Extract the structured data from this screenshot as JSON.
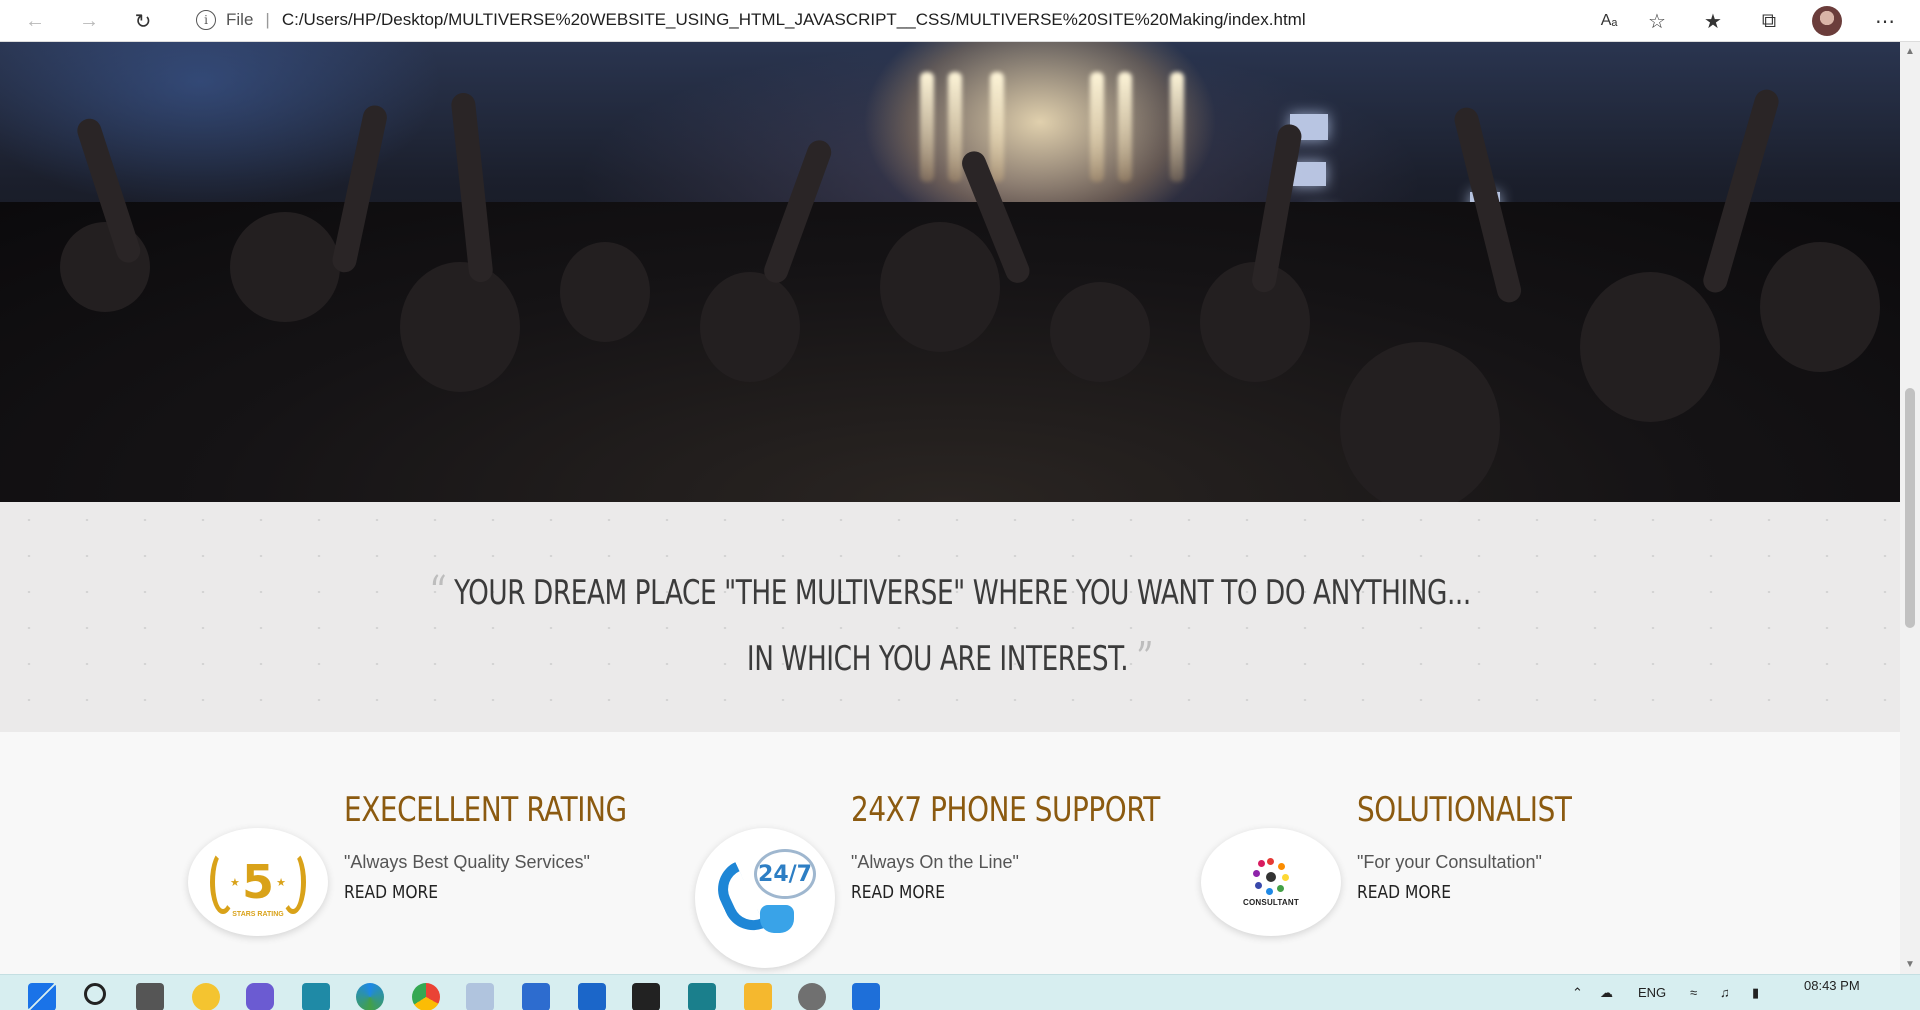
{
  "browser": {
    "back_icon": "back-arrow-icon",
    "forward_icon": "forward-arrow-icon",
    "reload_icon": "reload-icon",
    "info_glyph": "i",
    "file_label": "File",
    "separator": "|",
    "url": "C:/Users/HP/Desktop/MULTIVERSE%20WEBSITE_USING_HTML_JAVASCRIPT__CSS/MULTIVERSE%20SITE%20Making/index.html",
    "read_aloud_glyph": "Aₐ"
  },
  "quote": {
    "open_mark": "“",
    "line1": "YOUR DREAM PLACE \"THE MULTIVERSE\" WHERE YOU WANT TO DO ANYTHING...",
    "line2": "IN WHICH YOU ARE INTEREST.",
    "close_mark": "”"
  },
  "features": [
    {
      "title": "EXECELLENT RATING",
      "subtitle": "\"Always Best Quality Services\"",
      "link": "READ MORE",
      "badge_number": "5",
      "badge_text": "STARS RATING",
      "icon": "five-star-rating-icon"
    },
    {
      "title": "24X7 PHONE SUPPORT",
      "subtitle": "\"Always On the Line\"",
      "link": "READ MORE",
      "badge_text": "24/7",
      "icon": "phone-support-icon"
    },
    {
      "title": "SOLUTIONALIST",
      "subtitle": "\"For your Consultation\"",
      "link": "READ MORE",
      "badge_text": "CONSULTANT",
      "icon": "consultant-logo-icon"
    }
  ],
  "taskbar": {
    "language": "ENG",
    "time": "08:43 PM"
  },
  "colors": {
    "feature_title": "#8b5a10",
    "quote_text": "#3b3b3b",
    "taskbar_bg": "#d7eef0"
  }
}
